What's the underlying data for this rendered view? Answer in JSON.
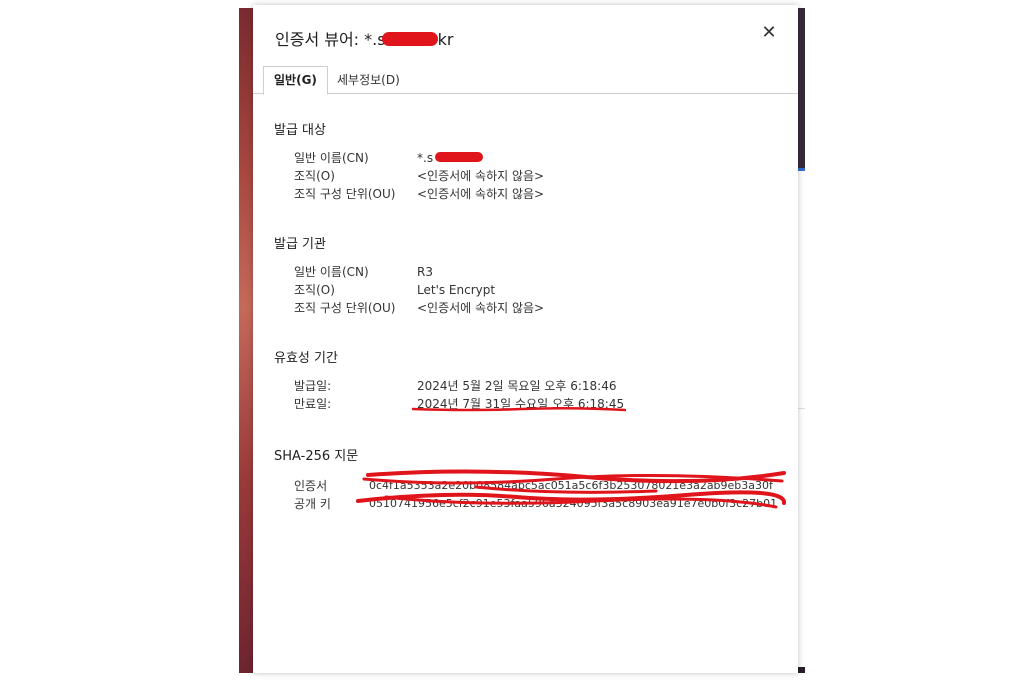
{
  "dialog": {
    "title": "인증서 뷰어: *.s",
    "title_suffix": "kr",
    "close_glyph": "✕",
    "tabs": {
      "general": "일반(G)",
      "details": "세부정보(D)"
    }
  },
  "issued_to": {
    "heading": "발급 대상",
    "rows": [
      {
        "label": "일반 이름(CN)",
        "value": "*.s"
      },
      {
        "label": "조직(O)",
        "value": "<인증서에 속하지 않음>"
      },
      {
        "label": "조직 구성 단위(OU)",
        "value": "<인증서에 속하지 않음>"
      }
    ]
  },
  "issued_by": {
    "heading": "발급 기관",
    "rows": [
      {
        "label": "일반 이름(CN)",
        "value": "R3"
      },
      {
        "label": "조직(O)",
        "value": "Let's Encrypt"
      },
      {
        "label": "조직 구성 단위(OU)",
        "value": "<인증서에 속하지 않음>"
      }
    ]
  },
  "validity": {
    "heading": "유효성 기간",
    "rows": [
      {
        "label": "발급일:",
        "value": "2024년 5월 2일 목요일 오후 6:18:46"
      },
      {
        "label": "만료일:",
        "value": "2024년 7월 31일 수요일 오후 6:18:45"
      }
    ]
  },
  "fingerprints": {
    "heading": "SHA-256 지문",
    "rows": [
      {
        "label": "인증서",
        "value": "0c4f1a5353a2e20b08584abc5ac051a5c6f3b253078021e3a2ab9eb3a30f"
      },
      {
        "label": "공개 키",
        "value": "0510741956e5cf2c91e53faa596a324095f3a5c8903ea91e7e0b0f3c27b01"
      }
    ]
  },
  "colors": {
    "redaction": "#e0141b",
    "accent": "#2f6fd6"
  }
}
